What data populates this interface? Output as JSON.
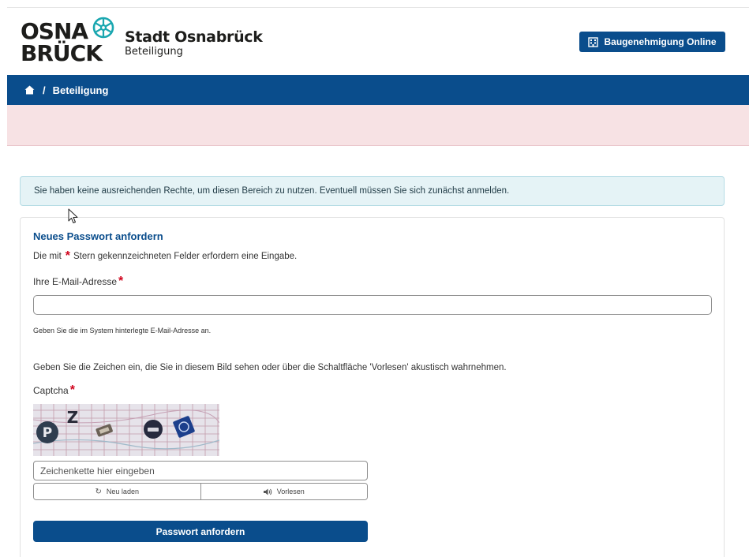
{
  "header": {
    "logo": {
      "line1": "OSNA",
      "line2": "BRÜCK",
      "mark_icon": "wheel-icon"
    },
    "site_title": "Stadt Osnabrück",
    "site_subtitle": "Beteiligung",
    "baugenehmigung_button": {
      "label": "Baugenehmigung Online",
      "icon": "building-icon"
    }
  },
  "breadcrumb": {
    "home_icon": "home-icon",
    "separator": "/",
    "current": "Beteiligung"
  },
  "info_message": "Sie haben keine ausreichenden Rechte, um diesen Bereich zu nutzen. Eventuell müssen Sie sich zunächst anmelden.",
  "form": {
    "title": "Neues Passwort anfordern",
    "required_note_before": "Die mit",
    "required_star": "*",
    "required_note_after": "Stern gekennzeichneten Felder erfordern eine Eingabe.",
    "email_label": "Ihre E-Mail-Adresse",
    "email_value": "",
    "email_hint": "Geben Sie die im System hinterlegte E-Mail-Adresse an.",
    "captcha_description": "Geben Sie die Zeichen ein, die Sie in diesem Bild sehen oder über die Schaltfläche 'Vorlesen' akustisch wahrnehmen.",
    "captcha_label": "Captcha",
    "captcha_placeholder": "Zeichenkette hier eingeben",
    "captcha_chars": {
      "c1": "P",
      "c2": "Z"
    },
    "reload_label": "Neu laden",
    "read_aloud_label": "Vorlesen",
    "submit_label": "Passwort anfordern"
  },
  "colors": {
    "brand_blue": "#0a4d8c",
    "alert_pink": "#f7e2e4",
    "info_bg": "#e5f3f6",
    "required_red": "#d0021b",
    "logo_teal": "#1aa7b0"
  }
}
